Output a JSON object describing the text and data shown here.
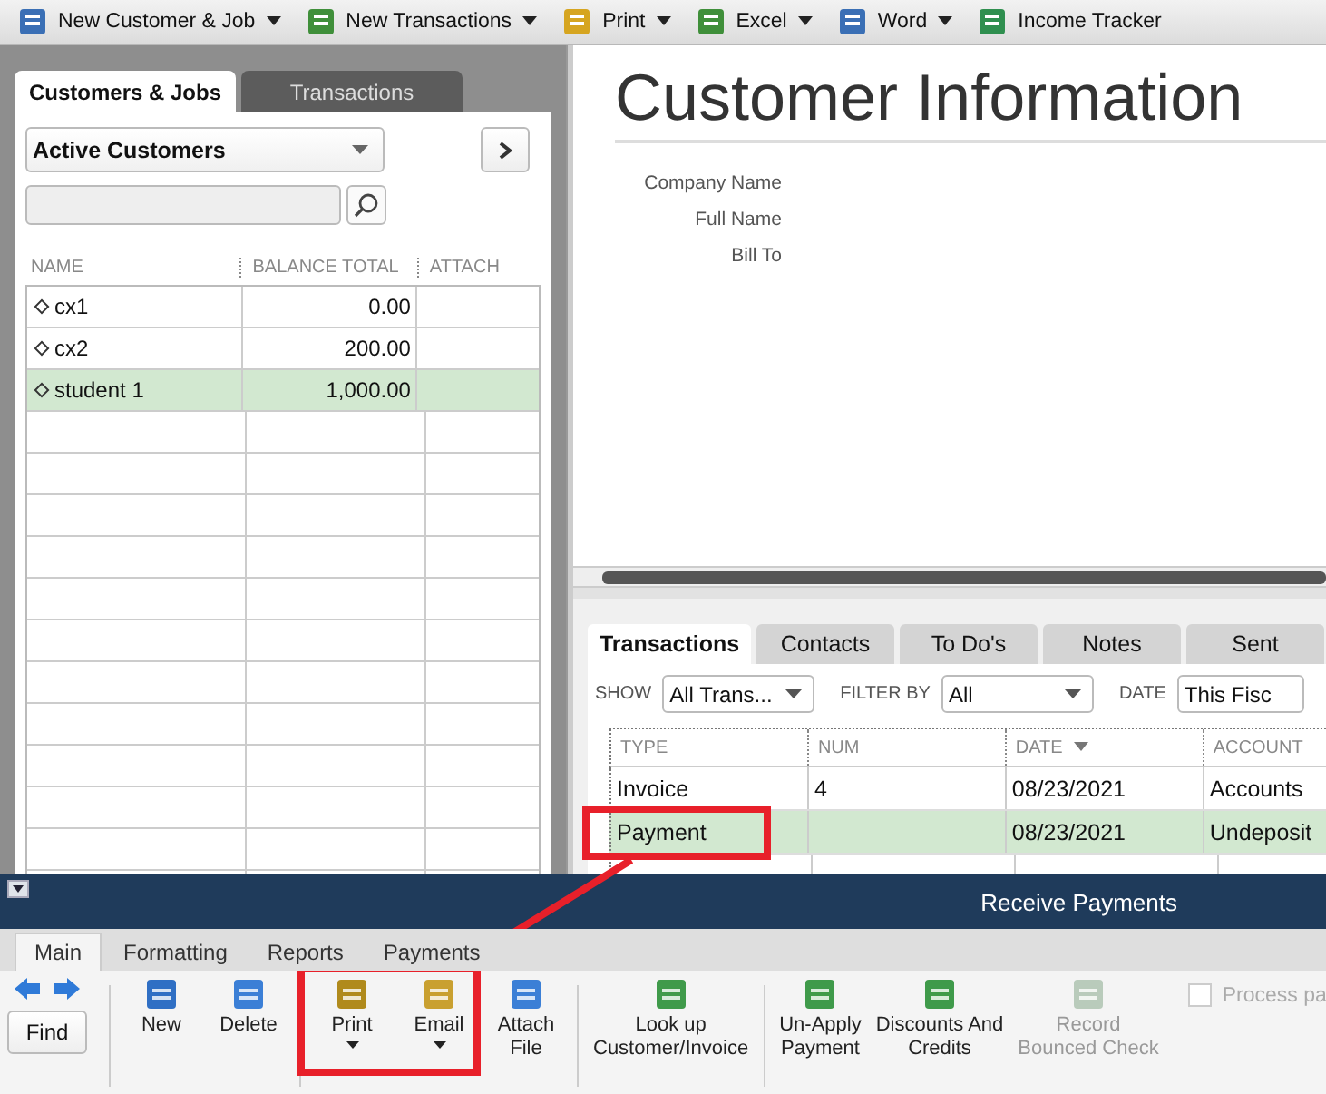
{
  "toolbar": [
    {
      "label": "New Customer & Job",
      "dropdown": true
    },
    {
      "label": "New Transactions",
      "dropdown": true
    },
    {
      "label": "Print",
      "dropdown": true
    },
    {
      "label": "Excel",
      "dropdown": true
    },
    {
      "label": "Word",
      "dropdown": true
    },
    {
      "label": "Income Tracker",
      "dropdown": false
    }
  ],
  "left_panel": {
    "tabs": [
      {
        "label": "Customers & Jobs",
        "selected": true
      },
      {
        "label": "Transactions",
        "selected": false
      }
    ],
    "view_filter": {
      "value": "Active Customers"
    },
    "columns": [
      "NAME",
      "BALANCE TOTAL",
      "ATTACH"
    ],
    "rows": [
      {
        "name": "cx1",
        "balance": "0.00",
        "selected": false
      },
      {
        "name": "cx2",
        "balance": "200.00",
        "selected": false
      },
      {
        "name": "student 1",
        "balance": "1,000.00",
        "selected": true
      }
    ]
  },
  "customer_info": {
    "title": "Customer Information",
    "fields": [
      "Company Name",
      "Full Name",
      "Bill To"
    ]
  },
  "detail_tabs": [
    {
      "label": "Transactions",
      "selected": true
    },
    {
      "label": "Contacts",
      "selected": false
    },
    {
      "label": "To Do's",
      "selected": false
    },
    {
      "label": "Notes",
      "selected": false
    },
    {
      "label": "Sent",
      "selected": false
    }
  ],
  "filters": [
    {
      "label": "SHOW",
      "value": "All Trans..."
    },
    {
      "label": "FILTER BY",
      "value": "All"
    },
    {
      "label": "DATE",
      "value": "This Fisc"
    }
  ],
  "transactions": {
    "columns": [
      "TYPE",
      "NUM",
      "DATE",
      "ACCOUNT"
    ],
    "rows": [
      {
        "type": "Invoice",
        "num": "4",
        "date": "08/23/2021",
        "account": "Accounts",
        "selected": false
      },
      {
        "type": "Payment",
        "num": "",
        "date": "08/23/2021",
        "account": "Undeposit",
        "selected": true
      }
    ]
  },
  "form": {
    "title": "Receive Payments",
    "tabs": [
      {
        "label": "Main",
        "selected": true
      },
      {
        "label": "Formatting",
        "selected": false
      },
      {
        "label": "Reports",
        "selected": false
      },
      {
        "label": "Payments",
        "selected": false
      }
    ],
    "find": "Find",
    "groups": [
      [
        {
          "label": "New",
          "kind": "button",
          "disabled": false
        },
        {
          "label": "Delete",
          "kind": "button",
          "disabled": false
        }
      ],
      [
        {
          "label": "Print",
          "kind": "menu",
          "disabled": false
        },
        {
          "label": "Email",
          "kind": "menu",
          "disabled": false
        },
        {
          "label": "Attach\nFile",
          "kind": "button",
          "disabled": false
        }
      ],
      [
        {
          "label": "Look up\nCustomer/Invoice",
          "kind": "button",
          "disabled": false
        }
      ],
      [
        {
          "label": "Un-Apply\nPayment",
          "kind": "button",
          "disabled": false
        },
        {
          "label": "Discounts And\nCredits",
          "kind": "button",
          "disabled": false
        },
        {
          "label": "Record\nBounced Check",
          "kind": "button",
          "disabled": true
        }
      ]
    ],
    "option": {
      "label": "Process pa",
      "checked": false
    }
  }
}
